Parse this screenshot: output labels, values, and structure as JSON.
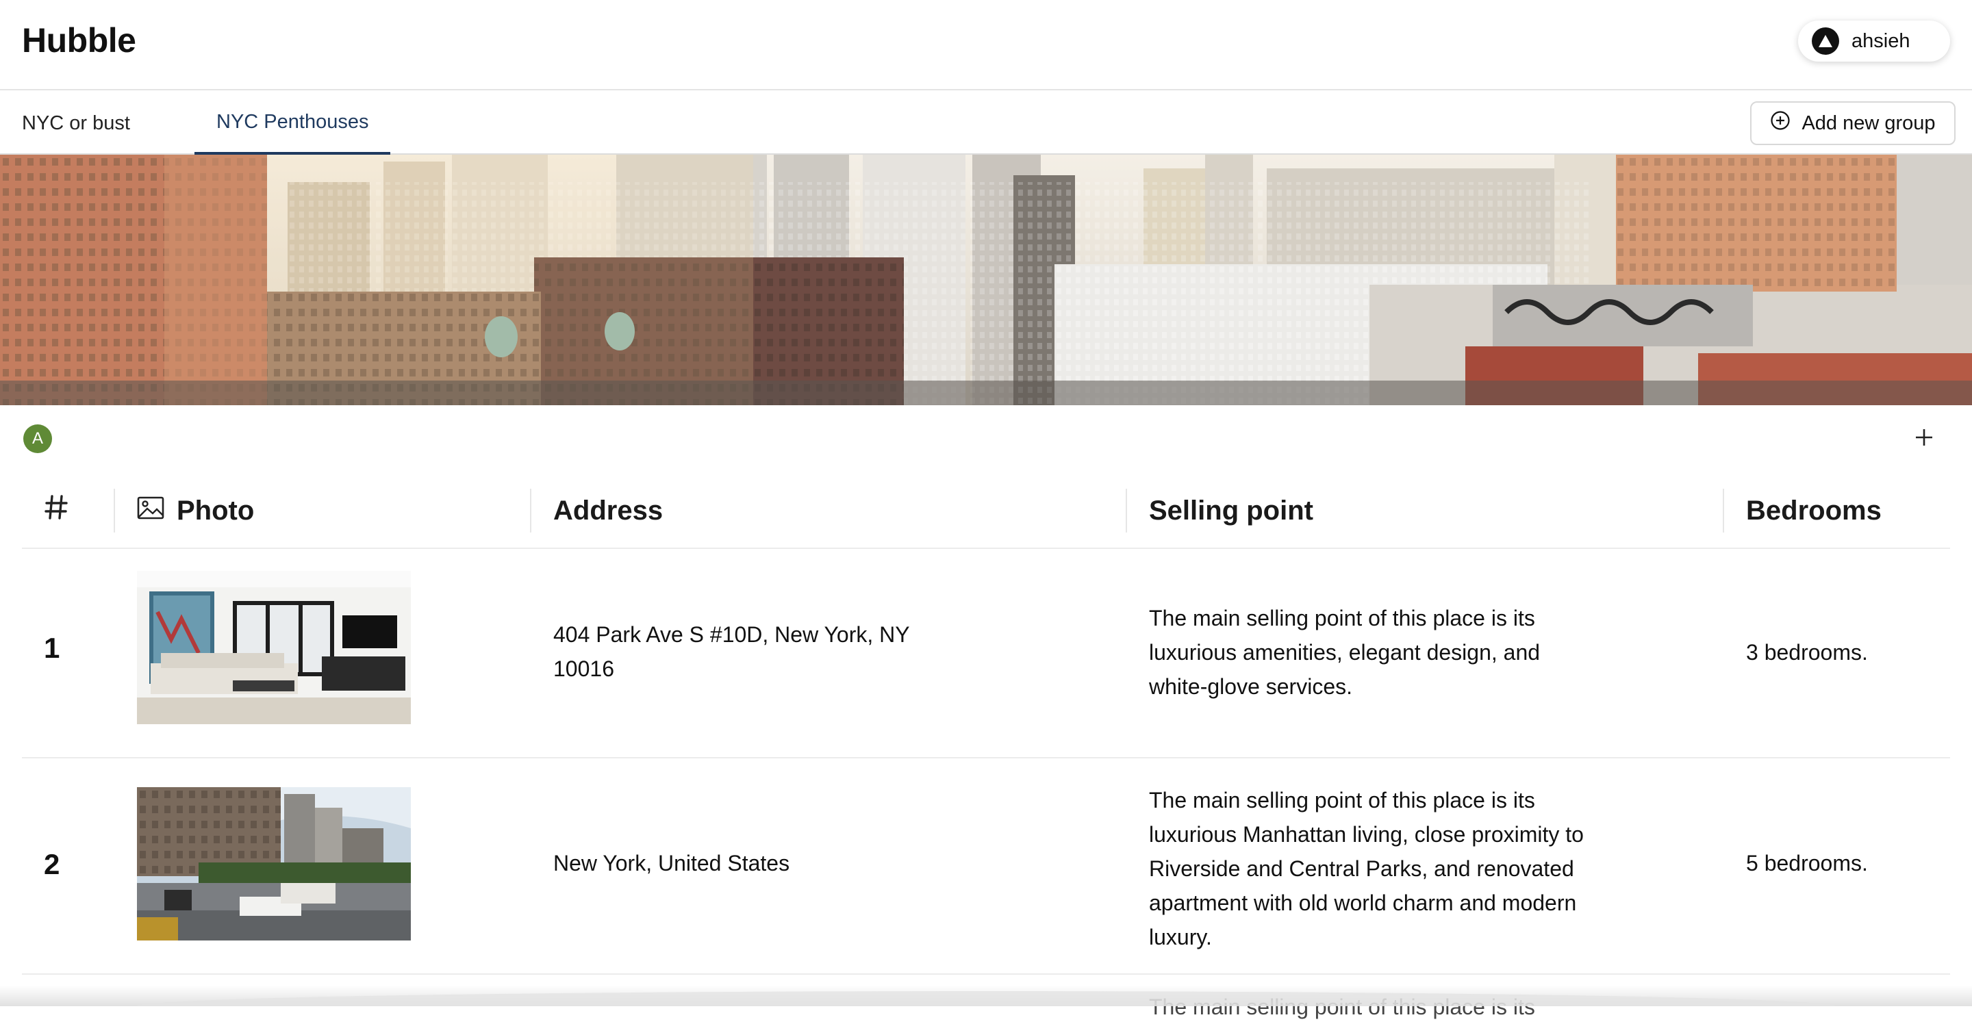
{
  "app": {
    "title": "Hubble"
  },
  "user": {
    "name": "ahsieh",
    "avatar_icon": "triangle-logo-icon"
  },
  "tabs": [
    {
      "label": "NYC or bust",
      "active": false
    },
    {
      "label": "NYC Penthouses",
      "active": true
    }
  ],
  "actions": {
    "add_group_label": "Add new group",
    "add_group_icon": "plus-circle-icon",
    "add_row_icon": "plus-icon"
  },
  "group": {
    "avatar_letter": "A",
    "avatar_color": "#5f8a36"
  },
  "table": {
    "columns": [
      {
        "label": "",
        "icon": "hash-icon"
      },
      {
        "label": "Photo",
        "icon": "image-icon"
      },
      {
        "label": "Address",
        "icon": ""
      },
      {
        "label": "Selling point",
        "icon": ""
      },
      {
        "label": "Bedrooms",
        "icon": ""
      }
    ],
    "rows": [
      {
        "num": "1",
        "address": "404 Park Ave S #10D, New York, NY 10016",
        "selling_point": "The main selling point of this place is its luxurious amenities, elegant design, and white-glove services.",
        "bedrooms": "3 bedrooms."
      },
      {
        "num": "2",
        "address": "New York, United States",
        "selling_point": "The main selling point of this place is its luxurious Manhattan living, close proximity to Riverside and Central Parks, and renovated apartment with old world charm and modern luxury.",
        "bedrooms": "5 bedrooms."
      },
      {
        "num": "",
        "address": "",
        "selling_point": "The main selling point of this place is its",
        "bedrooms": ""
      }
    ]
  },
  "colors": {
    "active_tab": "#1f3a5f",
    "border": "#e4e4e4"
  }
}
